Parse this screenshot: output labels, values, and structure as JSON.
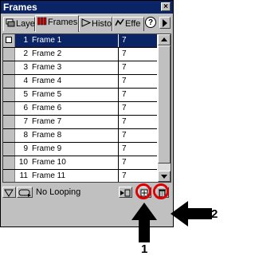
{
  "window": {
    "title": "Frames",
    "close_glyph": "×"
  },
  "tabs": [
    {
      "label": "Laye",
      "icon": "layers-icon"
    },
    {
      "label": "Frames",
      "icon": "frames-icon",
      "active": true
    },
    {
      "label": "Histo",
      "icon": "history-icon"
    },
    {
      "label": "Effe",
      "icon": "effects-icon"
    }
  ],
  "help_glyph": "?",
  "frames": [
    {
      "num": "1",
      "name": "Frame 1",
      "delay": "7",
      "selected": true
    },
    {
      "num": "2",
      "name": "Frame 2",
      "delay": "7"
    },
    {
      "num": "3",
      "name": "Frame 3",
      "delay": "7"
    },
    {
      "num": "4",
      "name": "Frame 4",
      "delay": "7"
    },
    {
      "num": "5",
      "name": "Frame 5",
      "delay": "7"
    },
    {
      "num": "6",
      "name": "Frame 6",
      "delay": "7"
    },
    {
      "num": "7",
      "name": "Frame 7",
      "delay": "7"
    },
    {
      "num": "8",
      "name": "Frame 8",
      "delay": "7"
    },
    {
      "num": "9",
      "name": "Frame 9",
      "delay": "7"
    },
    {
      "num": "10",
      "name": "Frame 10",
      "delay": "7"
    },
    {
      "num": "11",
      "name": "Frame 11",
      "delay": "7"
    }
  ],
  "bottom": {
    "loop_label": "No Looping",
    "icons": [
      "onion-skin-icon",
      "loop-icon",
      "distribute-to-frames-icon",
      "add-frame-icon",
      "delete-frame-icon"
    ]
  },
  "annotations": {
    "label_1": "1",
    "label_2": "2",
    "highlight_color": "#e00000"
  }
}
